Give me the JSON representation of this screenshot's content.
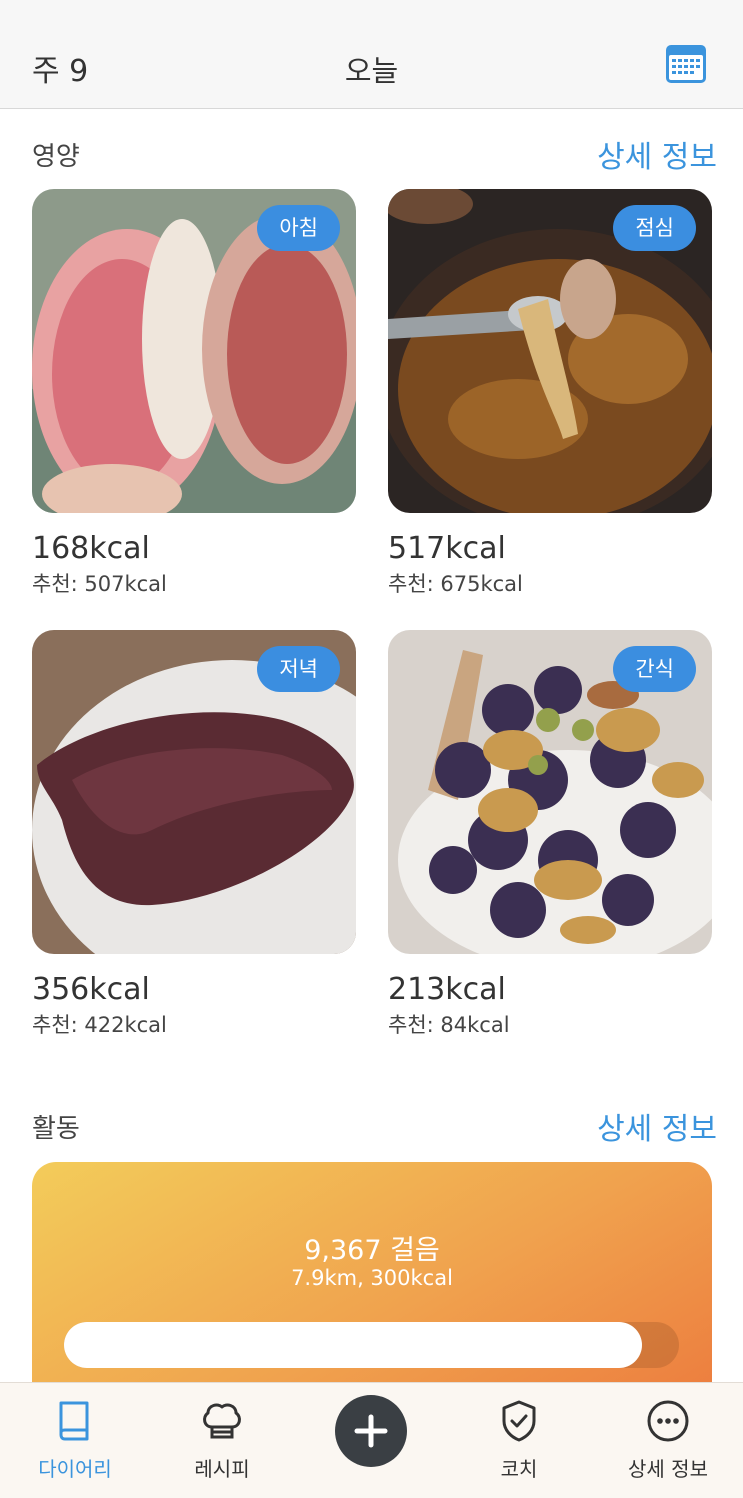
{
  "header": {
    "week": "주 9",
    "title": "오늘",
    "calendar_icon": "calendar-icon"
  },
  "nutrition": {
    "title": "영양",
    "link": "상세 정보",
    "meals": [
      {
        "tag": "아침",
        "kcal": "168kcal",
        "recommended": "추천: 507kcal"
      },
      {
        "tag": "점심",
        "kcal": "517kcal",
        "recommended": "추천: 675kcal"
      },
      {
        "tag": "저녁",
        "kcal": "356kcal",
        "recommended": "추천: 422kcal"
      },
      {
        "tag": "간식",
        "kcal": "213kcal",
        "recommended": "추천: 84kcal"
      }
    ]
  },
  "activity": {
    "title": "활동",
    "link": "상세 정보",
    "steps": "9,367 걸음",
    "details": "7.9km, 300kcal",
    "progress": 0.94
  },
  "tabbar": {
    "diary": {
      "label": "다이어리",
      "icon": "book-icon"
    },
    "recipe": {
      "label": "레시피",
      "icon": "chef-hat-icon"
    },
    "add": {
      "icon": "plus-icon"
    },
    "coach": {
      "label": "코치",
      "icon": "shield-check-icon"
    },
    "more": {
      "label": "상세 정보",
      "icon": "more-icon"
    }
  },
  "colors": {
    "accent": "#3b94dd",
    "tag": "#3b8ee0",
    "activity_start": "#f3cc5a",
    "activity_end": "#ec7a3d"
  }
}
